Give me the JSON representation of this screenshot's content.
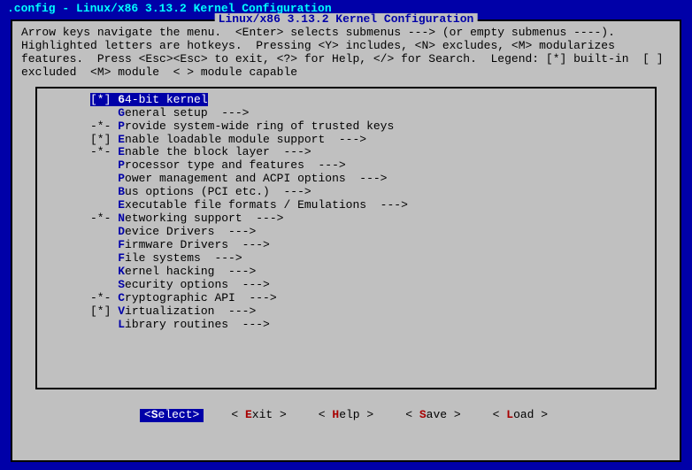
{
  "window_title": ".config - Linux/x86 3.13.2 Kernel Configuration",
  "dialog_title": "Linux/x86 3.13.2 Kernel Configuration",
  "help": "Arrow keys navigate the menu.  <Enter> selects submenus ---> (or empty submenus ----).  Highlighted letters are hotkeys.  Pressing <Y> includes, <N> excludes, <M> modularizes features.  Press <Esc><Esc> to exit, <?> for Help, </> for Search.  Legend: [*] built-in  [ ] excluded  <M> module  < > module capable",
  "items": [
    {
      "prefix": "   ",
      "mark": "[*]",
      "hot": "6",
      "rest": "4-bit kernel",
      "sel": true,
      "sub": false
    },
    {
      "prefix": "   ",
      "mark": "   ",
      "hot": "G",
      "rest": "eneral setup  --->",
      "sub": false
    },
    {
      "prefix": "-*-",
      "mark": "",
      "hot": "P",
      "rest": "rovide system-wide ring of trusted keys",
      "sub": false,
      "prefmark": true
    },
    {
      "prefix": "   ",
      "mark": "[*]",
      "hot": "E",
      "rest": "nable loadable module support  --->",
      "sub": false
    },
    {
      "prefix": "-*-",
      "mark": "",
      "hot": "E",
      "rest": "nable the block layer  --->",
      "sub": false,
      "prefmark": true
    },
    {
      "prefix": "   ",
      "mark": "   ",
      "hot": "P",
      "rest": "rocessor type and features  --->",
      "sub": false
    },
    {
      "prefix": "   ",
      "mark": "   ",
      "hot": "P",
      "rest": "ower management and ACPI options  --->",
      "sub": false
    },
    {
      "prefix": "   ",
      "mark": "   ",
      "hot": "B",
      "rest": "us options (PCI etc.)  --->",
      "sub": false
    },
    {
      "prefix": "   ",
      "mark": "   ",
      "hot": "E",
      "rest": "xecutable file formats / Emulations  --->",
      "sub": false
    },
    {
      "prefix": "-*-",
      "mark": "",
      "hot": "N",
      "rest": "etworking support  --->",
      "sub": false,
      "prefmark": true
    },
    {
      "prefix": "   ",
      "mark": "   ",
      "hot": "D",
      "rest": "evice Drivers  --->",
      "sub": false
    },
    {
      "prefix": "   ",
      "mark": "   ",
      "hot": "F",
      "rest": "irmware Drivers  --->",
      "sub": false
    },
    {
      "prefix": "   ",
      "mark": "   ",
      "hot": "F",
      "rest": "ile systems  --->",
      "sub": false
    },
    {
      "prefix": "   ",
      "mark": "   ",
      "hot": "K",
      "rest": "ernel hacking  --->",
      "sub": false
    },
    {
      "prefix": "   ",
      "mark": "   ",
      "hot": "S",
      "rest": "ecurity options  --->",
      "sub": false
    },
    {
      "prefix": "-*-",
      "mark": "",
      "hot": "C",
      "rest": "ryptographic API  --->",
      "sub": false,
      "prefmark": true
    },
    {
      "prefix": "   ",
      "mark": "[*]",
      "hot": "V",
      "rest": "irtualization  --->",
      "sub": false
    },
    {
      "prefix": "   ",
      "mark": "   ",
      "hot": "L",
      "rest": "ibrary routines  --->",
      "sub": false
    }
  ],
  "buttons": [
    {
      "pre": "<",
      "hk": "S",
      "rest": "elect>",
      "sel": true
    },
    {
      "pre": "< ",
      "hk": "E",
      "rest": "xit >",
      "sel": false
    },
    {
      "pre": "< ",
      "hk": "H",
      "rest": "elp >",
      "sel": false
    },
    {
      "pre": "< ",
      "hk": "S",
      "rest": "ave >",
      "sel": false
    },
    {
      "pre": "< ",
      "hk": "L",
      "rest": "oad >",
      "sel": false
    }
  ]
}
